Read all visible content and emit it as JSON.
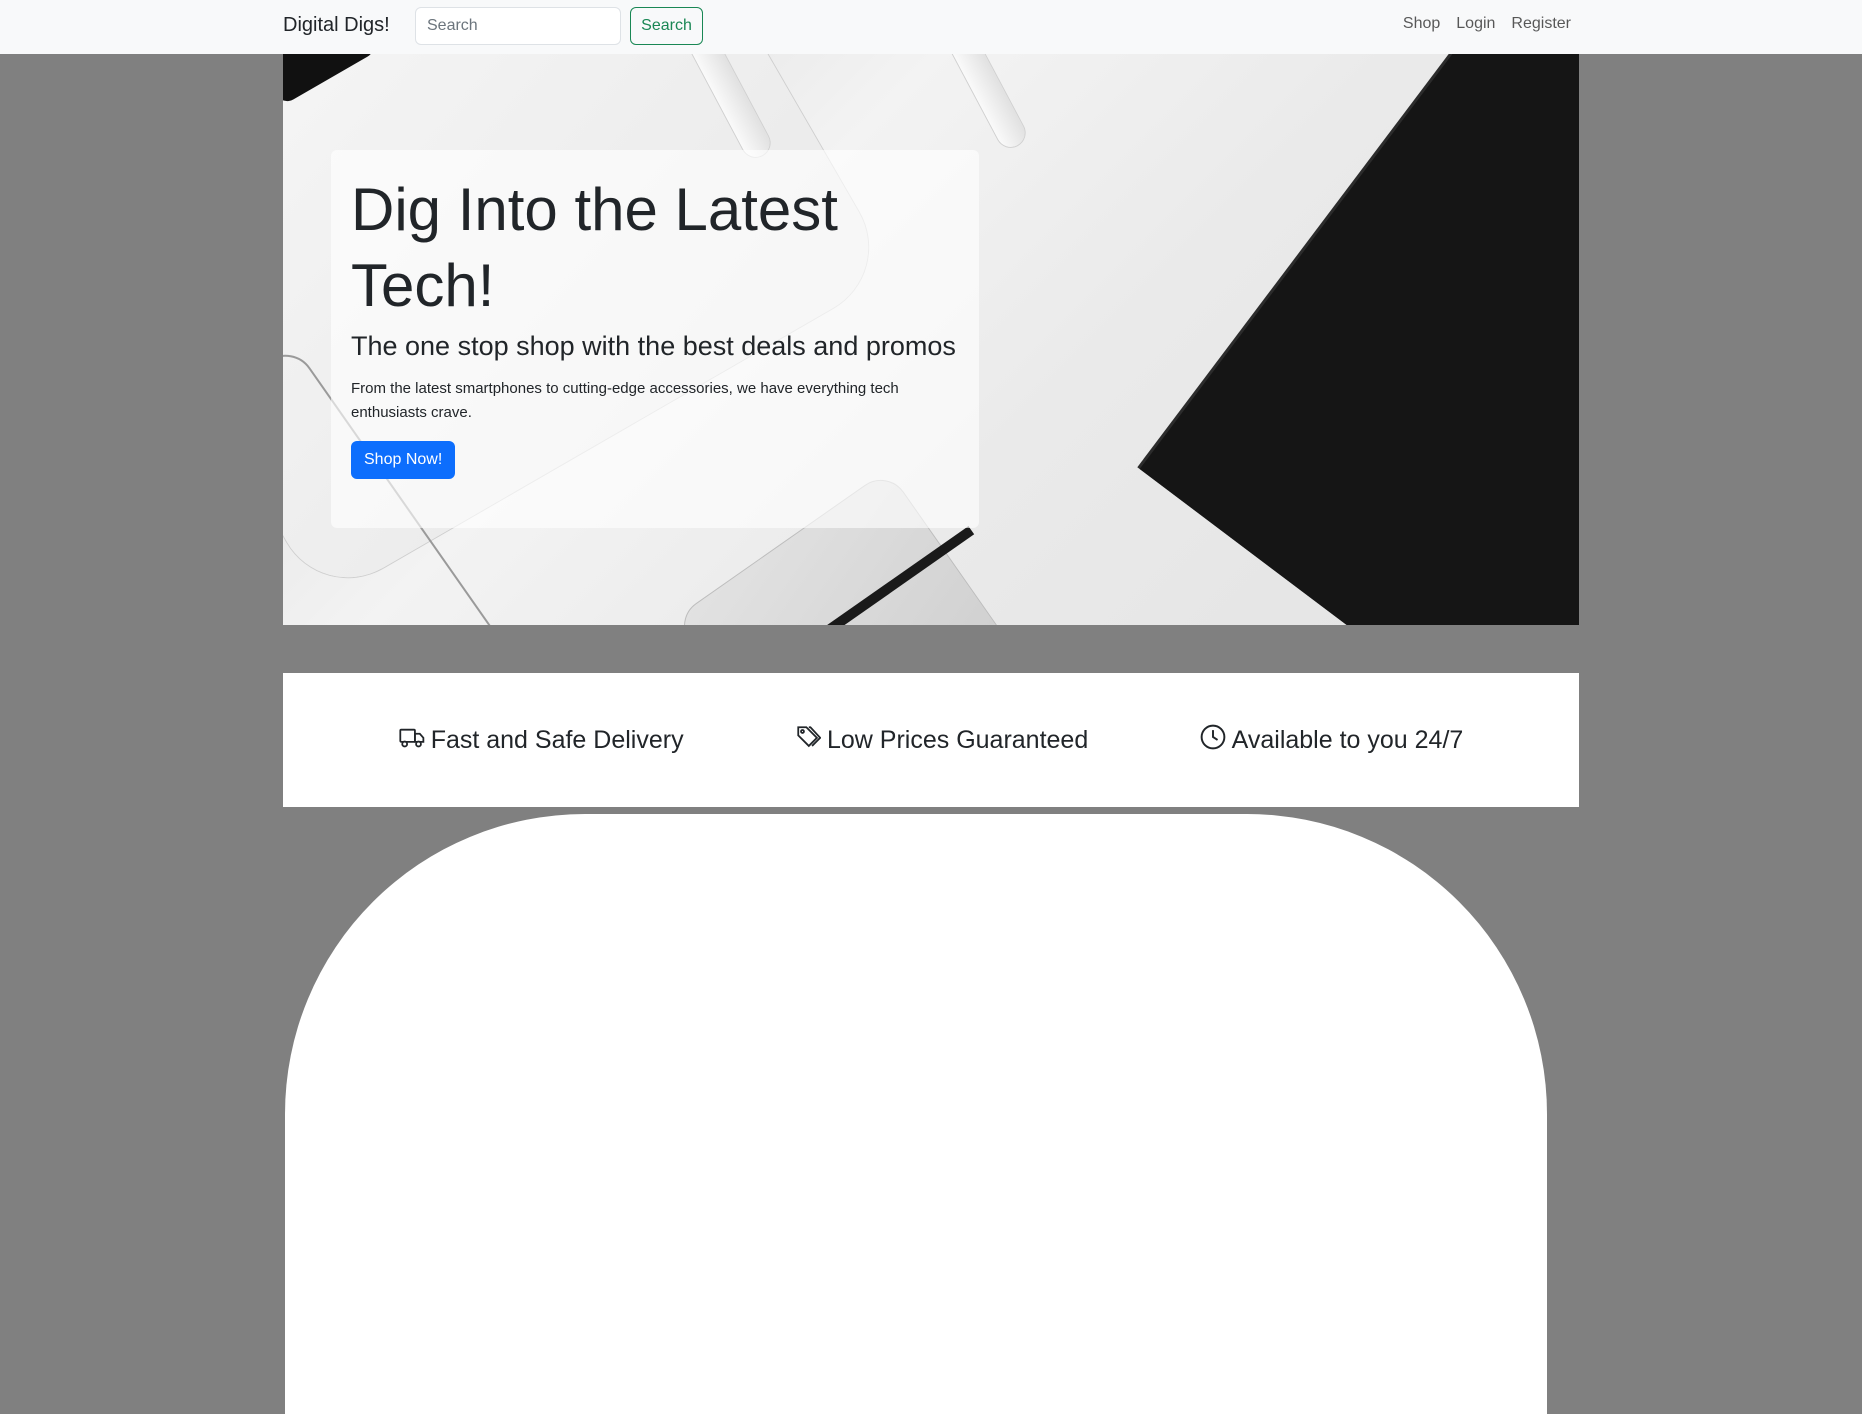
{
  "navbar": {
    "brand": "Digital Digs!",
    "search_placeholder": "Search",
    "search_button": "Search",
    "links": [
      "Shop",
      "Login",
      "Register"
    ]
  },
  "hero": {
    "title": "Dig Into the Latest Tech!",
    "subtitle": "The one stop shop with the best deals and promos",
    "text": "From the latest smartphones to cutting-edge accessories, we have everything tech enthusiasts crave.",
    "button": "Shop Now!"
  },
  "features": [
    {
      "icon": "truck-icon",
      "label": "Fast and Safe Delivery"
    },
    {
      "icon": "tags-icon",
      "label": "Low Prices Guaranteed"
    },
    {
      "icon": "clock-icon",
      "label": "Available to you 24/7"
    }
  ],
  "colors": {
    "primary": "#0d6efd",
    "success": "#198754",
    "navbar_bg": "#f8f9fa",
    "page_bg": "#808080"
  }
}
